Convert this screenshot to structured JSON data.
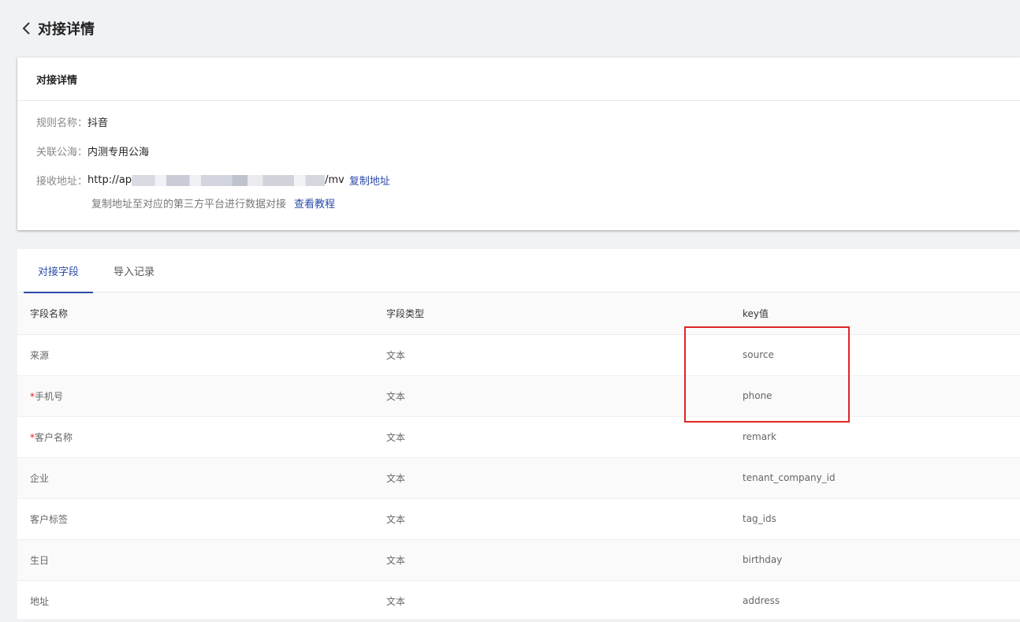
{
  "header": {
    "title": "对接详情",
    "back_icon": "chevron-left-icon"
  },
  "detail_card": {
    "title": "对接详情",
    "rule_name_label": "规则名称：",
    "rule_name_value": "抖音",
    "sea_label": "关联公海：",
    "sea_value": "内测专用公海",
    "address_label": "接收地址：",
    "address_prefix": "http://ap",
    "address_suffix": "/mv",
    "copy_link": "复制地址",
    "hint_text": "复制地址至对应的第三方平台进行数据对接",
    "tutorial_link": "查看教程"
  },
  "tabs": [
    {
      "label": "对接字段",
      "active": true
    },
    {
      "label": "导入记录",
      "active": false
    }
  ],
  "table": {
    "headers": [
      "字段名称",
      "字段类型",
      "key值"
    ],
    "rows": [
      {
        "name": "来源",
        "required": false,
        "type": "文本",
        "key": "source"
      },
      {
        "name": "手机号",
        "required": true,
        "type": "文本",
        "key": "phone"
      },
      {
        "name": "客户名称",
        "required": true,
        "type": "文本",
        "key": "remark"
      },
      {
        "name": "企业",
        "required": false,
        "type": "文本",
        "key": "tenant_company_id"
      },
      {
        "name": "客户标签",
        "required": false,
        "type": "文本",
        "key": "tag_ids"
      },
      {
        "name": "生日",
        "required": false,
        "type": "文本",
        "key": "birthday"
      },
      {
        "name": "地址",
        "required": false,
        "type": "文本",
        "key": "address"
      }
    ],
    "required_marker": "*"
  },
  "colors": {
    "accent": "#2b4aa8",
    "required": "#e02020",
    "highlight": "#e02525"
  }
}
